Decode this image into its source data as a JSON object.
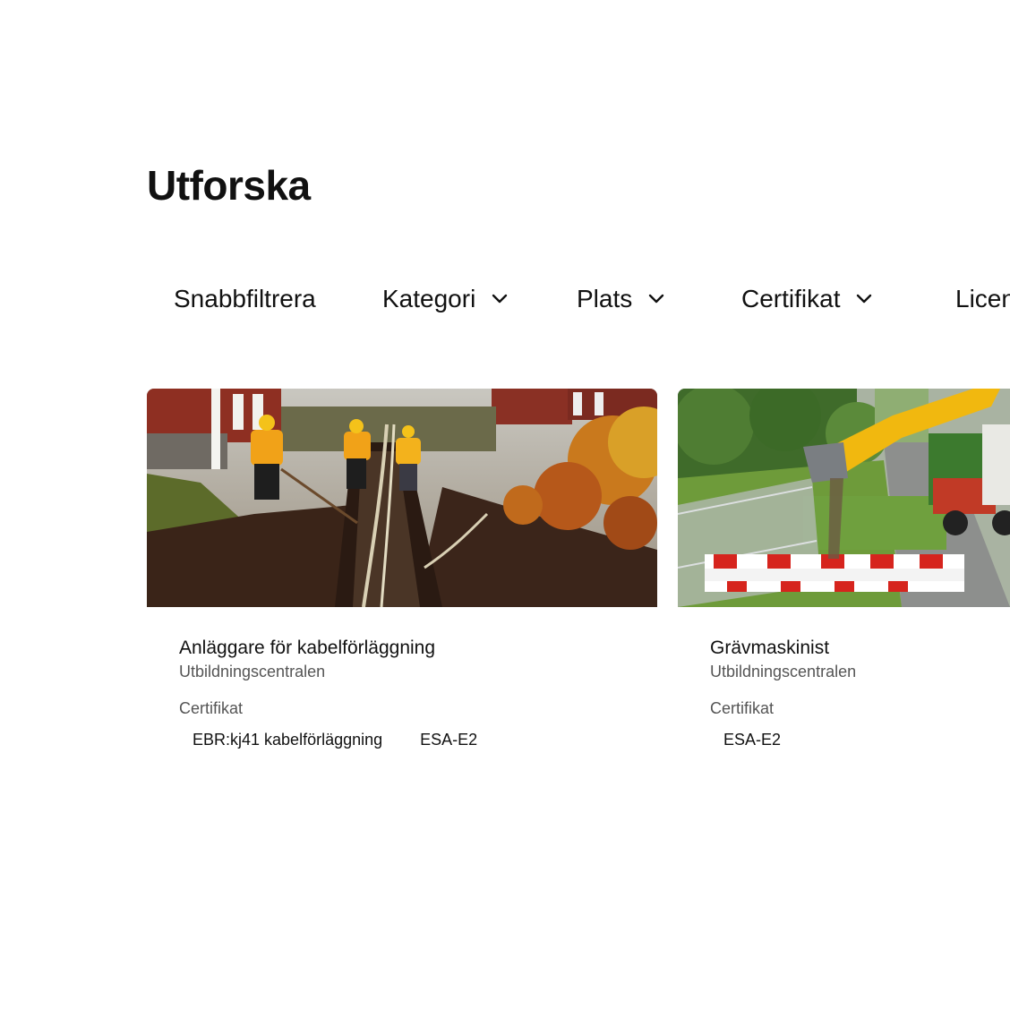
{
  "page": {
    "title": "Utforska"
  },
  "filters": [
    {
      "label": "Snabbfiltrera",
      "has_dropdown": false,
      "icon": ""
    },
    {
      "label": "Kategori",
      "has_dropdown": true,
      "icon": "chevron-down-icon"
    },
    {
      "label": "Plats",
      "has_dropdown": true,
      "icon": "chevron-down-icon"
    },
    {
      "label": "Certifikat",
      "has_dropdown": true,
      "icon": "chevron-down-icon"
    },
    {
      "label": "Licens",
      "has_dropdown": true,
      "icon": "chevron-down-icon"
    }
  ],
  "cards": [
    {
      "title": "Anläggare för kabelförläggning",
      "provider": "Utbildningscentralen",
      "cert_label": "Certifikat",
      "certificates": [
        "EBR:kj41 kabelförläggning",
        "ESA-E2"
      ],
      "image": "cable-trench-workers-photo"
    },
    {
      "title": "Grävmaskinist",
      "provider": "Utbildningscentralen",
      "cert_label": "Certifikat",
      "certificates": [
        "ESA-E2"
      ],
      "image": "excavator-roadwork-photo"
    }
  ],
  "colors": {
    "text": "#111111",
    "muted": "#555555",
    "background": "#ffffff"
  }
}
